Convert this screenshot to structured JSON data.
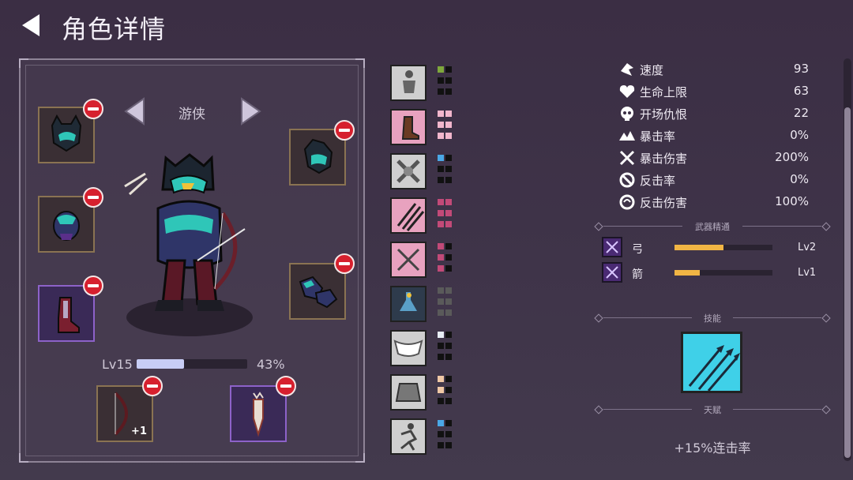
{
  "header": {
    "title": "角色详情"
  },
  "character": {
    "class_name": "游侠",
    "level_label": "Lv15",
    "xp_percent_text": "43%",
    "xp_fraction": 0.43
  },
  "equipment": {
    "bow_upgrade_label": "+1"
  },
  "gear_pips": [
    {
      "colors": [
        "#7fa83c",
        "#111",
        "#111",
        "#111",
        "#111",
        "#111"
      ]
    },
    {
      "colors": [
        "#f2b6cc",
        "#f2b6cc",
        "#f2b6cc",
        "#f2b6cc",
        "#f2b6cc",
        "#f2b6cc"
      ]
    },
    {
      "colors": [
        "#4aa8e6",
        "#111",
        "#111",
        "#111",
        "#111",
        "#111"
      ]
    },
    {
      "colors": [
        "#c24a78",
        "#c24a78",
        "#c24a78",
        "#c24a78",
        "#c24a78",
        "#c24a78"
      ]
    },
    {
      "colors": [
        "#c24a78",
        "#111",
        "#c24a78",
        "#111",
        "#c24a78",
        "#111"
      ]
    },
    {
      "colors": [
        "#5a5a5a",
        "#5a5a5a",
        "#5a5a5a",
        "#5a5a5a",
        "#5a5a5a",
        "#5a5a5a"
      ]
    },
    {
      "colors": [
        "#e8eef5",
        "#111",
        "#111",
        "#111",
        "#111",
        "#111"
      ]
    },
    {
      "colors": [
        "#f0c8a6",
        "#111",
        "#f0c8a6",
        "#111",
        "#111",
        "#111"
      ]
    },
    {
      "colors": [
        "#4aa8e6",
        "#111",
        "#111",
        "#111",
        "#111",
        "#111"
      ]
    }
  ],
  "stats": [
    {
      "icon": "speed-icon",
      "label": "速度",
      "value": "93"
    },
    {
      "icon": "heart-icon",
      "label": "生命上限",
      "value": "63"
    },
    {
      "icon": "skull-icon",
      "label": "开场仇恨",
      "value": "22"
    },
    {
      "icon": "crit-icon",
      "label": "暴击率",
      "value": "0%"
    },
    {
      "icon": "crit-damage-icon",
      "label": "暴击伤害",
      "value": "200%"
    },
    {
      "icon": "counter-icon",
      "label": "反击率",
      "value": "0%"
    },
    {
      "icon": "counter-damage-icon",
      "label": "反击伤害",
      "value": "100%"
    }
  ],
  "sections": {
    "weapon_mastery": "武器精通",
    "skills": "技能",
    "talent": "天赋"
  },
  "weapon_mastery": [
    {
      "icon": "bow-icon",
      "label": "弓",
      "level": "Lv2",
      "progress": 0.5
    },
    {
      "icon": "arrow-icon",
      "label": "箭",
      "level": "Lv1",
      "progress": 0.26
    }
  ],
  "talent": {
    "text": "+15%连击率"
  },
  "colors": {
    "accent_gold": "#f1b544",
    "remove_red": "#d6202e",
    "xp_bar": "#c8cdf5"
  }
}
